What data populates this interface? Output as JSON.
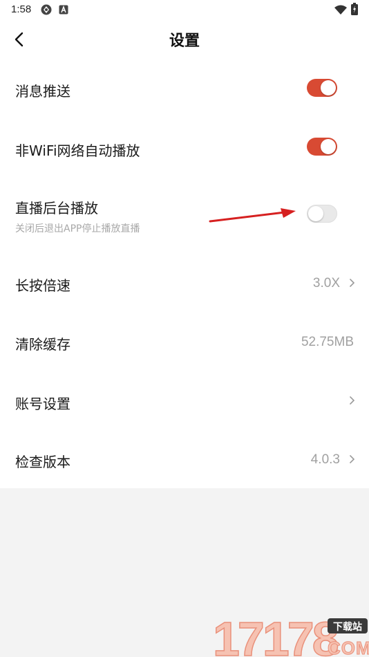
{
  "status_bar": {
    "time": "1:58"
  },
  "header": {
    "title": "设置"
  },
  "settings": {
    "push": {
      "label": "消息推送",
      "enabled": true
    },
    "wifi_autoplay": {
      "label": "非WiFi网络自动播放",
      "enabled": true
    },
    "live_background": {
      "label": "直播后台播放",
      "subtitle": "关闭后退出APP停止播放直播",
      "enabled": false
    },
    "long_press_speed": {
      "label": "长按倍速",
      "value": "3.0X"
    },
    "clear_cache": {
      "label": "清除缓存",
      "value": "52.75MB"
    },
    "account": {
      "label": "账号设置"
    },
    "check_version": {
      "label": "检查版本",
      "value": "4.0.3"
    }
  },
  "watermark": {
    "digits": "17178",
    "badge": "下载站",
    "domain": "COM"
  },
  "colors": {
    "accent": "#d84a33",
    "annotation_arrow": "#d62020",
    "watermark": "#f0a090"
  }
}
